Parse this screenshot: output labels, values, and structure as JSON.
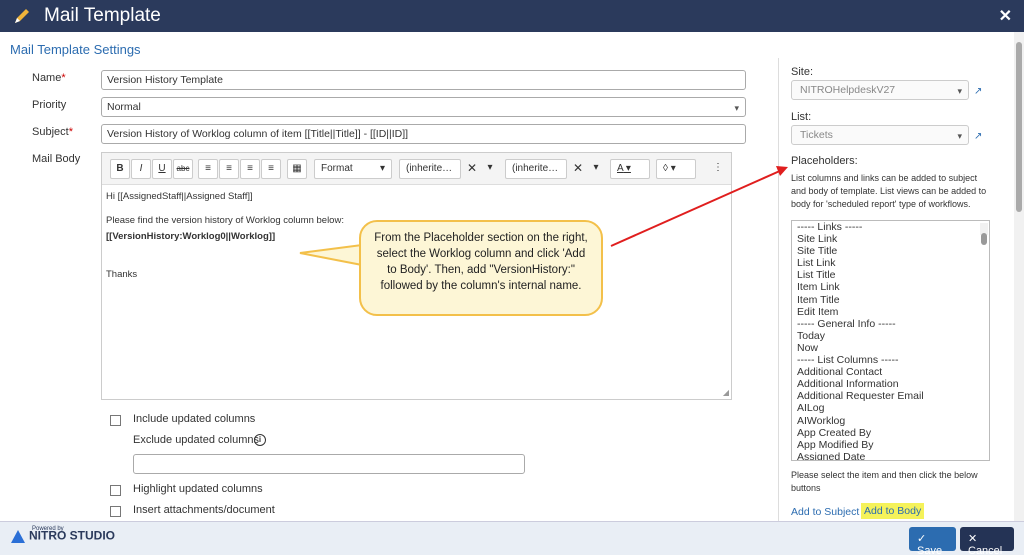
{
  "header": {
    "title": "Mail Template",
    "close": "✕"
  },
  "section_title": "Mail Template Settings",
  "form": {
    "name_label": "Name",
    "name_value": "Version History Template",
    "priority_label": "Priority",
    "priority_value": "Normal",
    "subject_label": "Subject",
    "subject_value": "Version History of Worklog column of item [[Title||Title]] - [[ID||ID]]",
    "body_label": "Mail Body"
  },
  "toolbar": {
    "bold": "B",
    "italic": "I",
    "underline": "U",
    "strike": "abc",
    "format": "Format",
    "font1": "(inherite…",
    "font2": "(inherite…",
    "fontcolor": "A"
  },
  "editor": {
    "line1": "Hi [[AssignedStaff||Assigned Staff]]",
    "line2": "Please find the version history of Worklog column below:",
    "line3": "[[VersionHistory:Worklog0||Worklog]]",
    "line4": "Thanks"
  },
  "callout": "From the Placeholder section on the right, select the Worklog column and click 'Add to Body'. Then, add \"VersionHistory:\" followed by the column's internal name.",
  "options": {
    "include_updated": "Include updated columns",
    "exclude_updated": "Exclude updated columns",
    "highlight_updated": "Highlight updated columns",
    "insert_attachments": "Insert attachments/document"
  },
  "right": {
    "site_label": "Site:",
    "site_value": "NITROHelpdeskV27",
    "list_label": "List:",
    "list_value": "Tickets",
    "placeholders_label": "Placeholders:",
    "help_text": "List columns and links can be added to subject and body of template. List views can be added to body for 'scheduled report' type of workflows.",
    "placeholders": [
      "----- Links -----",
      "Site Link",
      "Site Title",
      "List Link",
      "List Title",
      "Item Link",
      "Item Title",
      "Edit Item",
      "----- General Info -----",
      "Today",
      "Now",
      "----- List Columns -----",
      "Additional Contact",
      "Additional Information",
      "Additional Requester Email",
      "AILog",
      "AIWorklog",
      "App Created By",
      "App Modified By",
      "Assigned Date"
    ],
    "select_hint": "Please select the item and then click the below buttons",
    "add_subject": "Add to Subject",
    "add_body": "Add to Body"
  },
  "footer": {
    "logo_small": "Powered by",
    "logo": "NITRO STUDIO",
    "save": "Save",
    "cancel": "Cancel"
  },
  "colors": {
    "header": "#2b3a5c",
    "accent": "#2c6cb0",
    "highlight": "#f5f25a",
    "arrow": "#e01e1e"
  }
}
